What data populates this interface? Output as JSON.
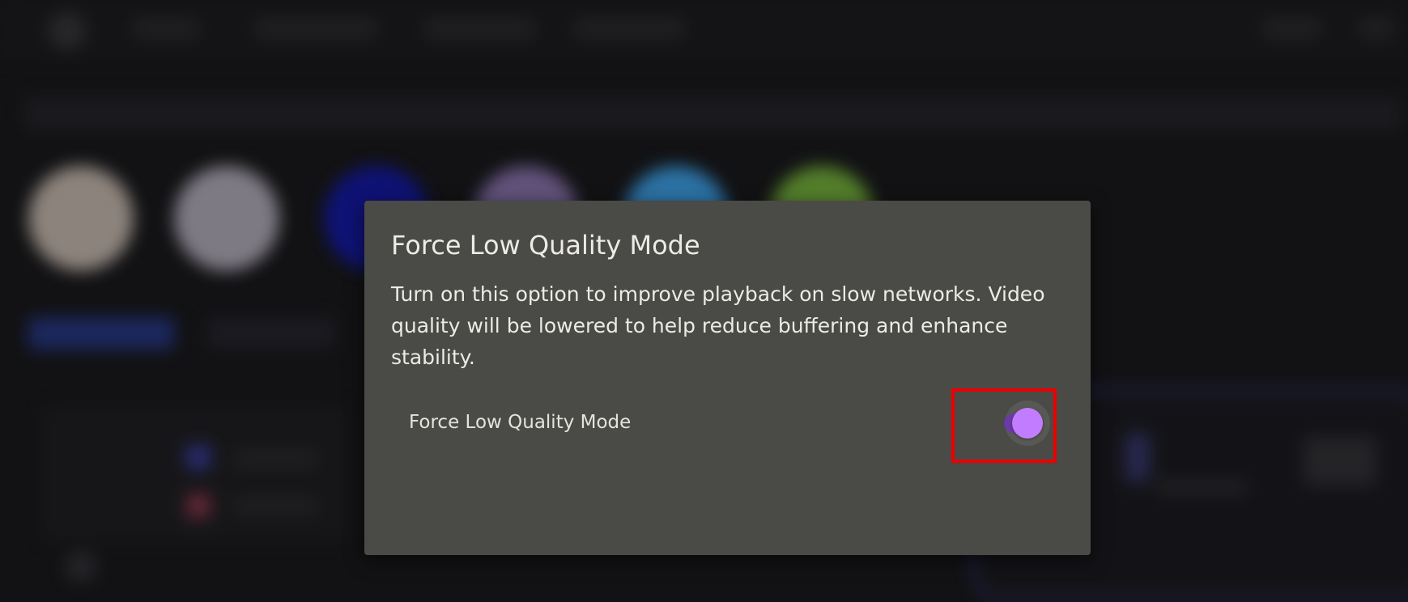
{
  "dialog": {
    "title": "Force Low Quality Mode",
    "description": "Turn on this option to improve playback on slow networks. Video quality will be lowered to help reduce buffering and enhance stability.",
    "setting": {
      "label": "Force Low Quality Mode",
      "enabled": true
    }
  },
  "colors": {
    "dialog_background": "#4a4a46",
    "toggle_thumb": "#c27cff",
    "toggle_track": "#6a3aa6",
    "highlight_outline": "#ee0000",
    "page_background": "#121214"
  },
  "icons": {
    "toggle": "toggle-switch-icon"
  }
}
